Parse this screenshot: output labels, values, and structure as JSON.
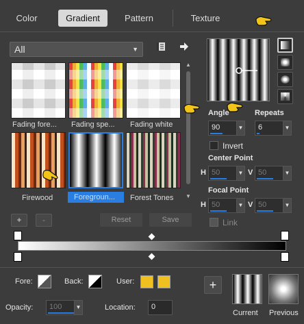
{
  "tabs": [
    "Color",
    "Gradient",
    "Pattern",
    "Texture"
  ],
  "category": {
    "value": "All"
  },
  "gradients": [
    {
      "label": "Fading fore...",
      "selected": false
    },
    {
      "label": "Fading spe...",
      "selected": false
    },
    {
      "label": "Fading white",
      "selected": false
    },
    {
      "label": "Firewood",
      "selected": false
    },
    {
      "label": "Foregroun...",
      "selected": true
    },
    {
      "label": "Forest Tones",
      "selected": false
    }
  ],
  "angle": {
    "label": "Angle",
    "value": "90"
  },
  "repeats": {
    "label": "Repeats",
    "value": "6"
  },
  "invert": {
    "label": "Invert",
    "checked": false
  },
  "center_point": {
    "label": "Center Point",
    "h_label": "H",
    "h": "50",
    "v_label": "V",
    "v": "50"
  },
  "focal_point": {
    "label": "Focal Point",
    "h_label": "H",
    "h": "50",
    "v_label": "V",
    "v": "50"
  },
  "link": {
    "label": "Link"
  },
  "actions": {
    "add": "+",
    "remove": "-",
    "reset": "Reset",
    "save": "Save"
  },
  "fore": {
    "label": "Fore:"
  },
  "back": {
    "label": "Back:"
  },
  "user": {
    "label": "User:"
  },
  "opacity": {
    "label": "Opacity:",
    "value": "100"
  },
  "location": {
    "label": "Location:",
    "value": "0"
  },
  "current": {
    "label": "Current"
  },
  "previous": {
    "label": "Previous"
  },
  "colors": {
    "accent": "#2a7de1",
    "user_swatch": "#f0c020"
  }
}
